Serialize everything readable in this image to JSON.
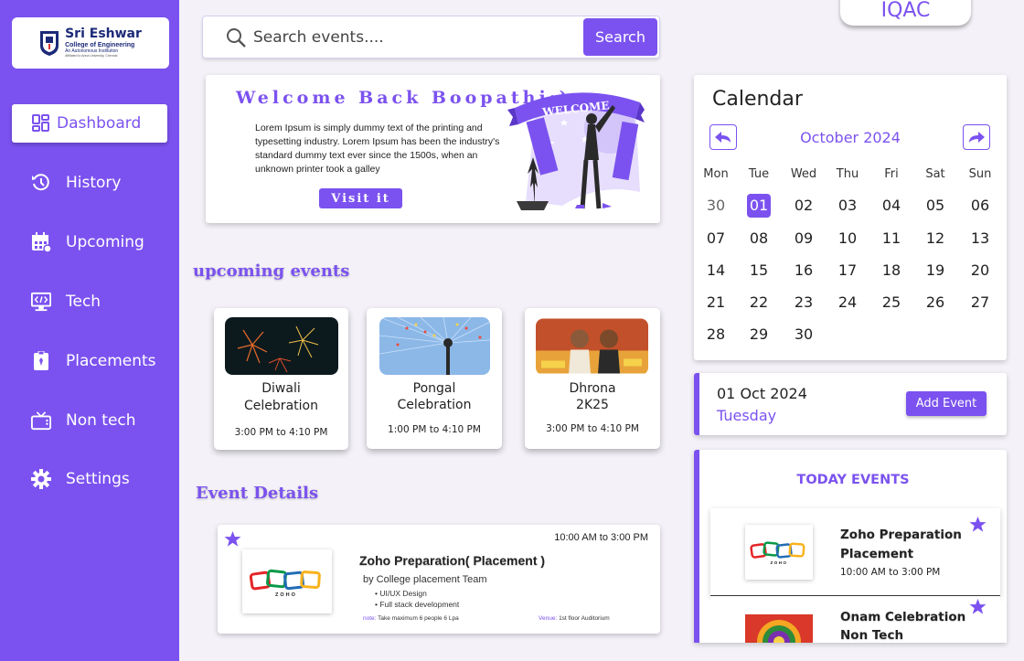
{
  "brand": {
    "name": "Sri Eshwar",
    "subtitle": "College of Engineering",
    "tagline": "An Autonomous Institution",
    "affiliation": "Affiliated to Anna University, Chennai",
    "accent_color": "#7b52ef"
  },
  "sidebar": {
    "items": [
      {
        "label": "Dashboard",
        "icon": "dashboard-icon",
        "active": true
      },
      {
        "label": "History",
        "icon": "history-icon"
      },
      {
        "label": "Upcoming",
        "icon": "calendar-icon"
      },
      {
        "label": "Tech",
        "icon": "code-monitor-icon"
      },
      {
        "label": "Placements",
        "icon": "id-badge-icon"
      },
      {
        "label": "Non tech",
        "icon": "tv-icon"
      },
      {
        "label": "Settings",
        "icon": "gear-icon"
      }
    ]
  },
  "search": {
    "placeholder": "Search events....",
    "button": "Search"
  },
  "header": {
    "iqac": "IQAC"
  },
  "welcome": {
    "title": "Welcome  Back Boopathi:)",
    "body": "Lorem Ipsum is simply dummy text of the printing and typesetting industry. Lorem Ipsum has been the industry's standard dummy text ever since the 1500s, when an unknown printer took a galley",
    "button": "Visit it",
    "banner": "WELCOME"
  },
  "upcoming": {
    "heading": "upcoming events",
    "events": [
      {
        "name_line1": "Diwali",
        "name_line2": "Celebration",
        "time": "3:00 PM to 4:10 PM"
      },
      {
        "name_line1": "Pongal",
        "name_line2": "Celebration",
        "time": "1:00 PM to 4:10 PM"
      },
      {
        "name_line1": "Dhrona",
        "name_line2": "2K25",
        "time": "3:00 PM to 4:10 PM"
      }
    ]
  },
  "details": {
    "heading": "Event Details",
    "time": "10:00 AM to 3:00 PM",
    "title": "Zoho Preparation( Placement )",
    "by": "by College placement Team",
    "bullets": [
      "UI/UX Design",
      "Full stack development"
    ],
    "note_label": "note:",
    "note": "Take maximum 6 people 6 Lpa",
    "venue_label": "Venue:",
    "venue": "1st floor Auditorium"
  },
  "calendar": {
    "title": "Calendar",
    "month": "October 2024",
    "weekdays": [
      "Mon",
      "Tue",
      "Wed",
      "Thu",
      "Fri",
      "Sat",
      "Sun"
    ],
    "weeks": [
      [
        "30",
        "01",
        "02",
        "03",
        "04",
        "05",
        "06"
      ],
      [
        "07",
        "08",
        "09",
        "10",
        "11",
        "12",
        "13"
      ],
      [
        "14",
        "15",
        "16",
        "17",
        "18",
        "19",
        "20"
      ],
      [
        "21",
        "22",
        "23",
        "24",
        "25",
        "26",
        "27"
      ],
      [
        "28",
        "29",
        "30",
        "",
        "",
        "",
        ""
      ]
    ],
    "selected": "01"
  },
  "date_bar": {
    "date": "01 Oct 2024",
    "day": "Tuesday",
    "button": "Add Event"
  },
  "today": {
    "title": "TODAY EVENTS",
    "items": [
      {
        "name_line1": "Zoho Preparation",
        "name_line2": "Placement",
        "time": "10:00 AM to 3:00 PM"
      },
      {
        "name_line1": "Onam Celebration",
        "name_line2": "Non Tech",
        "time": ""
      }
    ]
  }
}
